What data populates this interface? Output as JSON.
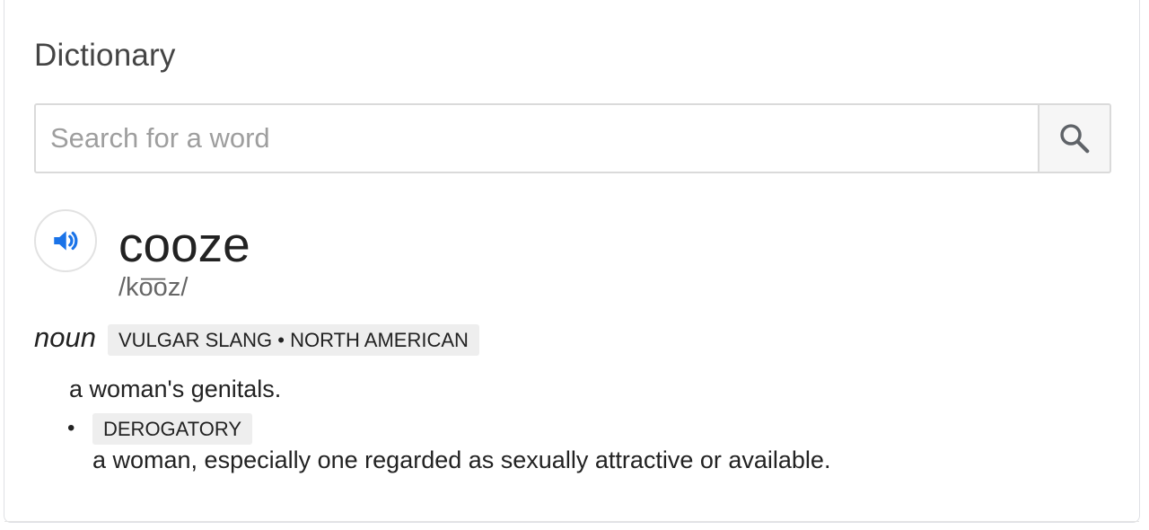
{
  "dictionary": {
    "title": "Dictionary",
    "search": {
      "placeholder": "Search for a word",
      "value": ""
    },
    "entry": {
      "headword": "cooze",
      "phonetic": "/ko͞oz/",
      "part_of_speech": "noun",
      "usage_labels": "VULGAR SLANG • NORTH AMERICAN",
      "definitions": [
        {
          "tag": "",
          "text": "a woman's genitals."
        },
        {
          "tag": "DEROGATORY",
          "text": "a woman, especially one regarded as sexually attractive or available."
        }
      ]
    },
    "colors": {
      "audio_icon": "#1a73e8",
      "search_icon": "#5f6368",
      "tag_background": "#eeeeee"
    },
    "icons": {
      "audio": "speaker-icon",
      "search": "search-icon"
    }
  }
}
